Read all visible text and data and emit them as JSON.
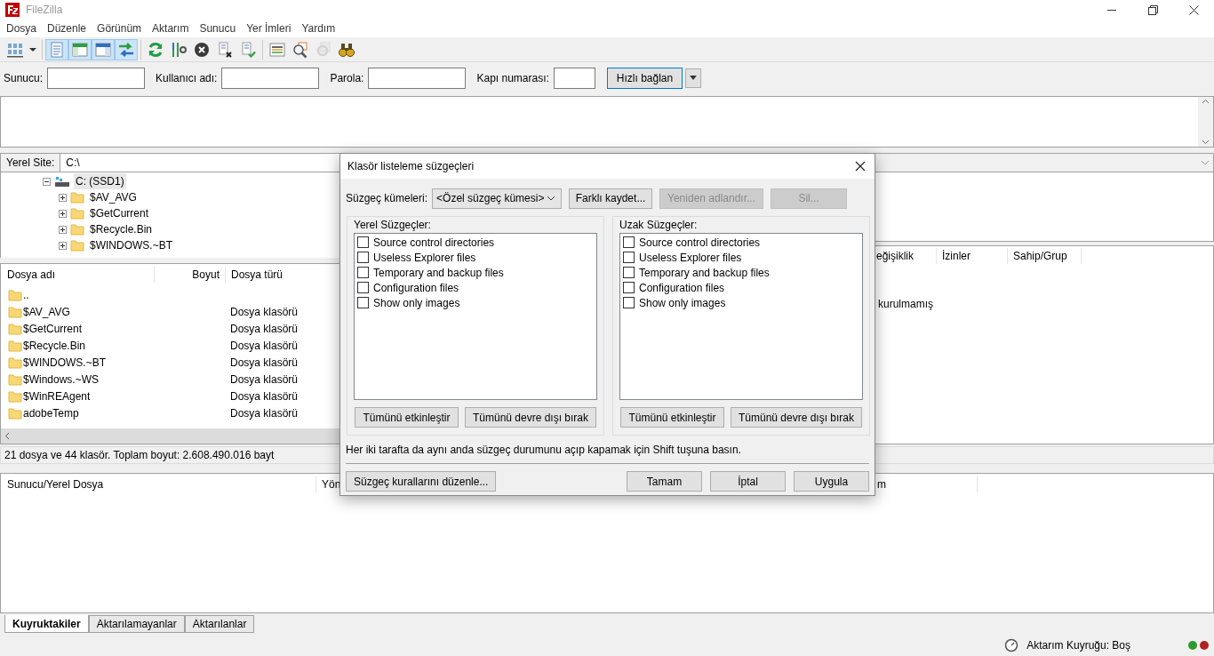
{
  "window": {
    "title": "FileZilla"
  },
  "menu": [
    "Dosya",
    "Düzenle",
    "Görünüm",
    "Aktarım",
    "Sunucu",
    "Yer İmleri",
    "Yardım"
  ],
  "toolbar": [
    {
      "kind": "sitemanager",
      "selected": false,
      "disabled": false
    },
    {
      "kind": "caret",
      "selected": false,
      "disabled": false
    },
    {
      "kind": "log",
      "selected": true,
      "disabled": false
    },
    {
      "kind": "localtree",
      "selected": true,
      "disabled": false
    },
    {
      "kind": "remotetree",
      "selected": true,
      "disabled": false
    },
    {
      "kind": "queue",
      "selected": true,
      "disabled": false
    },
    {
      "kind": "refresh",
      "selected": false,
      "disabled": false
    },
    {
      "kind": "process",
      "selected": false,
      "disabled": false
    },
    {
      "kind": "cancel",
      "selected": false,
      "disabled": false
    },
    {
      "kind": "disconnect",
      "selected": false,
      "disabled": false
    },
    {
      "kind": "reconnect",
      "selected": false,
      "disabled": false
    },
    {
      "kind": "filter",
      "selected": false,
      "disabled": false
    },
    {
      "kind": "compare",
      "selected": false,
      "disabled": false
    },
    {
      "kind": "sync",
      "selected": false,
      "disabled": true
    },
    {
      "kind": "search",
      "selected": false,
      "disabled": false
    }
  ],
  "quickconnect": {
    "fields": [
      {
        "label": "Sunucu:"
      },
      {
        "label": "Kullanıcı adı:"
      },
      {
        "label": "Parola:"
      },
      {
        "label": "Kapı numarası:"
      }
    ],
    "button": "Hızlı bağlan"
  },
  "local": {
    "site_label": "Yerel Site:",
    "path": "C:\\",
    "tree": {
      "label": "C: (SSD1)",
      "expanded": true,
      "selected": true,
      "children": [
        {
          "label": "$AV_AVG",
          "expanded": false,
          "selected": false
        },
        {
          "label": "$GetCurrent",
          "expanded": false,
          "selected": false
        },
        {
          "label": "$Recycle.Bin",
          "expanded": false,
          "selected": false
        },
        {
          "label": "$WINDOWS.~BT",
          "expanded": false,
          "selected": false
        }
      ]
    },
    "columns": [
      "Dosya adı",
      "Boyut",
      "Dosya türü"
    ],
    "rows": [
      {
        "name": ".."
      },
      {
        "name": "$AV_AVG",
        "type": "Dosya klasörü"
      },
      {
        "name": "$GetCurrent",
        "type": "Dosya klasörü"
      },
      {
        "name": "$Recycle.Bin",
        "type": "Dosya klasörü"
      },
      {
        "name": "$WINDOWS.~BT",
        "type": "Dosya klasörü"
      },
      {
        "name": "$Windows.~WS",
        "type": "Dosya klasörü"
      },
      {
        "name": "$WinREAgent",
        "type": "Dosya klasörü"
      },
      {
        "name": "adobeTemp",
        "type": "Dosya klasörü"
      }
    ],
    "status": "21 dosya ve 44 klasör. Toplam boyut: 2.608.490.016 bayt"
  },
  "remote": {
    "columns": [
      "eğişiklik",
      "İzinler",
      "Sahip/Grup"
    ],
    "message": "kurulmamış"
  },
  "queue": {
    "columns": [
      "Sunucu/Yerel Dosya",
      "Yön",
      "m"
    ]
  },
  "queue_tabs": [
    {
      "label": "Kuyruktakiler",
      "selected": true
    },
    {
      "label": "Aktarılamayanlar",
      "selected": false
    },
    {
      "label": "Aktarılanlar",
      "selected": false
    }
  ],
  "status_bar": {
    "queue": "Aktarım Kuyruğu: Boş",
    "lights": [
      {
        "color": "#2e9a2e"
      },
      {
        "color": "#b22222"
      }
    ]
  },
  "dialog": {
    "title": "Klasör listeleme süzgeçleri",
    "sets_label": "Süzgeç kümeleri:",
    "sets_value": "<Özel süzgeç kümesi>",
    "set_buttons": [
      {
        "label": "Farklı kaydet...",
        "disabled": false
      },
      {
        "label": "Yeniden adlandır...",
        "disabled": true
      },
      {
        "label": "Sil...",
        "disabled": true
      }
    ],
    "panels": [
      {
        "title": "Yerel Süzgeçler:",
        "items": [
          {
            "label": "Source control directories",
            "checked": false
          },
          {
            "label": "Useless Explorer files",
            "checked": false
          },
          {
            "label": "Temporary and backup files",
            "checked": false
          },
          {
            "label": "Configuration files",
            "checked": false
          },
          {
            "label": "Show only images",
            "checked": false
          }
        ],
        "buttons": [
          "Tümünü etkinleştir",
          "Tümünü devre dışı bırak"
        ]
      },
      {
        "title": "Uzak Süzgeçler:",
        "items": [
          {
            "label": "Source control directories",
            "checked": false
          },
          {
            "label": "Useless Explorer files",
            "checked": false
          },
          {
            "label": "Temporary and backup files",
            "checked": false
          },
          {
            "label": "Configuration files",
            "checked": false
          },
          {
            "label": "Show only images",
            "checked": false
          }
        ],
        "buttons": [
          "Tümünü etkinleştir",
          "Tümünü devre dışı bırak"
        ]
      }
    ],
    "hint": "Her iki tarafta da aynı anda süzgeç durumunu açıp kapamak için Shift tuşuna basın.",
    "edit_button": "Süzgeç kurallarını düzenle...",
    "buttons": [
      "Tamam",
      "İptal",
      "Uygula"
    ]
  }
}
